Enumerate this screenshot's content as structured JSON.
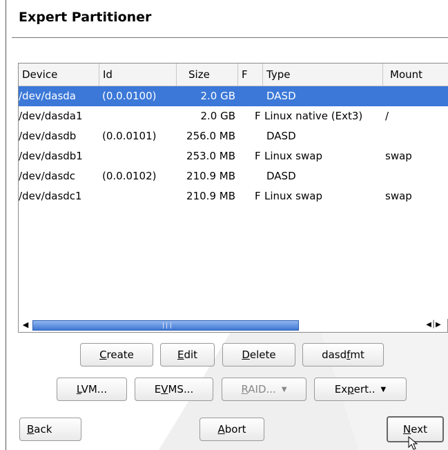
{
  "window": {
    "title": "Expert Partitioner"
  },
  "table": {
    "columns": [
      "Device",
      "Id",
      "Size",
      "F",
      "Type",
      "Mount"
    ],
    "rows": [
      {
        "device": "/dev/dasda",
        "id": "(0.0.0100)",
        "size": "2.0 GB",
        "f": "",
        "type": "DASD",
        "mount": "",
        "selected": true
      },
      {
        "device": "/dev/dasda1",
        "id": "",
        "size": "2.0 GB",
        "f": "F",
        "type": "Linux native (Ext3)",
        "mount": "/",
        "selected": false
      },
      {
        "device": "/dev/dasdb",
        "id": "(0.0.0101)",
        "size": "256.0 MB",
        "f": "",
        "type": "DASD",
        "mount": "",
        "selected": false
      },
      {
        "device": "/dev/dasdb1",
        "id": "",
        "size": "253.0 MB",
        "f": "F",
        "type": "Linux swap",
        "mount": "swap",
        "selected": false
      },
      {
        "device": "/dev/dasdc",
        "id": "(0.0.0102)",
        "size": "210.9 MB",
        "f": "",
        "type": "DASD",
        "mount": "",
        "selected": false
      },
      {
        "device": "/dev/dasdc1",
        "id": "",
        "size": "210.9 MB",
        "f": "F",
        "type": "Linux swap",
        "mount": "swap",
        "selected": false
      }
    ]
  },
  "scrollbar": {
    "left_icon": "arrow-left-icon",
    "right_icon": "arrow-left-right-icon"
  },
  "buttons_row1": {
    "create": {
      "mnemonic": "C",
      "rest": "reate"
    },
    "edit": {
      "mnemonic": "E",
      "rest": "dit"
    },
    "delete": {
      "mnemonic": "D",
      "rest": "elete"
    },
    "dasdfmt": {
      "pre": "dasd",
      "mnemonic": "f",
      "rest": "mt"
    }
  },
  "buttons_row2": {
    "lvm": {
      "mnemonic": "L",
      "rest": "VM..."
    },
    "evms": {
      "pre": "E",
      "mnemonic": "V",
      "rest": "MS..."
    },
    "raid": {
      "mnemonic": "R",
      "rest": "AID...",
      "disabled": true
    },
    "expert": {
      "pre": "Ex",
      "mnemonic": "p",
      "rest": "ert.."
    }
  },
  "footer": {
    "back": {
      "mnemonic": "B",
      "rest": "ack"
    },
    "abort": {
      "mnemonic": "A",
      "rest": "bort"
    },
    "next": {
      "mnemonic": "N",
      "rest": "ext"
    }
  },
  "colors": {
    "selection": "#3b78d8",
    "scroll_thumb": "#3f77d4",
    "watermark": "#eeeeee"
  }
}
